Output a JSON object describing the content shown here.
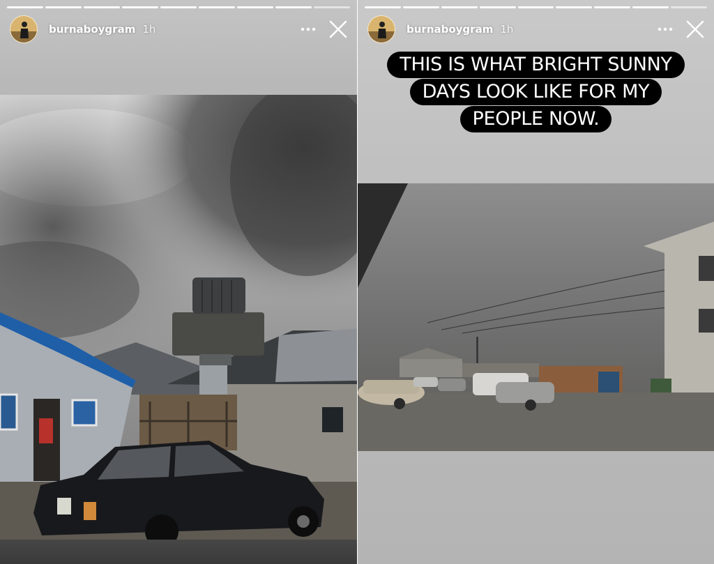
{
  "left_story": {
    "username": "burnaboygram",
    "timestamp": "1h",
    "progress": {
      "segments": 9,
      "completed": 8
    },
    "icons": {
      "avatar": "avatar",
      "more": "more-options-icon",
      "close": "close-icon"
    },
    "photo": "dark-smoke-over-houses-and-black-car"
  },
  "right_story": {
    "username": "burnaboygram",
    "timestamp": "1h",
    "progress": {
      "segments": 9,
      "completed": 8
    },
    "caption_lines": [
      "THIS IS WHAT BRIGHT SUNNY",
      "DAYS LOOK LIKE FOR MY",
      "PEOPLE NOW."
    ],
    "icons": {
      "avatar": "avatar",
      "more": "more-options-icon",
      "close": "close-icon"
    },
    "photo": "hazy-grey-street-with-parked-cars"
  },
  "colors": {
    "caption_bg": "#000000",
    "caption_text": "#ffffff",
    "header_text": "#ffffff"
  }
}
